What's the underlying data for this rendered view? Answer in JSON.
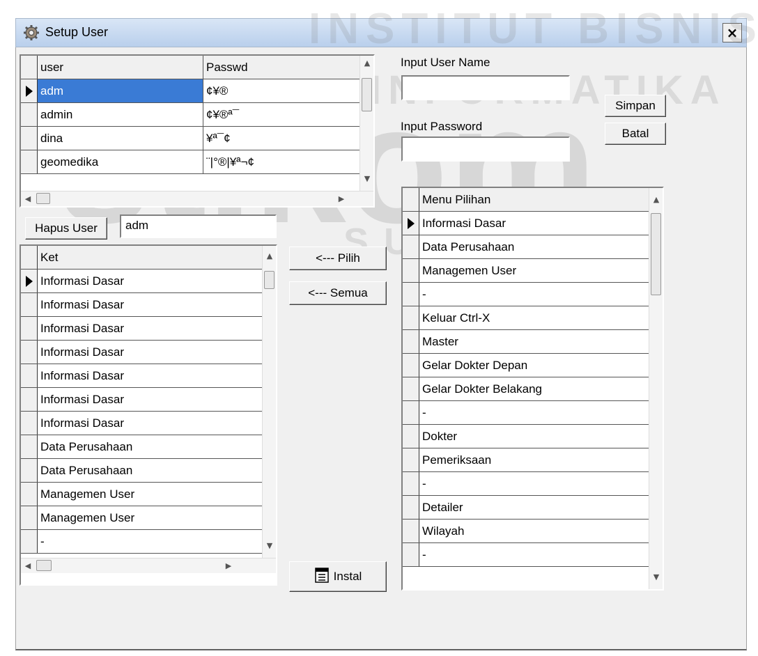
{
  "window": {
    "title": "Setup User",
    "close_label": "×"
  },
  "watermark": {
    "line1": "INSTITUT BISNIS",
    "line2": "& INFORMATIKA",
    "logo": "stikom",
    "line3": "SURABAYA"
  },
  "user_grid": {
    "headers": [
      "user",
      "Passwd"
    ],
    "rows": [
      [
        "adm",
        "¢¥®"
      ],
      [
        "admin",
        "¢¥®ª¯"
      ],
      [
        "dina",
        "¥ª¯¢"
      ],
      [
        "geomedika",
        "¨|°®|¥ª¬¢"
      ]
    ]
  },
  "form": {
    "user_name_label": "Input User Name",
    "password_label": "Input Password",
    "user_name_value": "",
    "password_value": "",
    "simpan_label": "Simpan",
    "batal_label": "Batal",
    "hapus_label": "Hapus User",
    "hapus_value": "adm"
  },
  "ket_grid": {
    "header": "Ket",
    "rows": [
      "Informasi Dasar",
      "Informasi Dasar",
      "Informasi Dasar",
      "Informasi Dasar",
      "Informasi Dasar",
      "Informasi Dasar",
      "Informasi Dasar",
      "Data Perusahaan",
      "Data Perusahaan",
      "Managemen User",
      "Managemen User",
      "-"
    ]
  },
  "actions": {
    "pilih_label": "<--- Pilih",
    "semua_label": "<--- Semua",
    "instal_label": "Instal"
  },
  "menu_grid": {
    "header": "Menu Pilihan",
    "rows": [
      "Informasi Dasar",
      "Data Perusahaan",
      "Managemen User",
      "-",
      "Keluar   Ctrl-X",
      "Master",
      "Gelar Dokter Depan",
      "Gelar Dokter Belakang",
      "-",
      "Dokter",
      "Pemeriksaan",
      "-",
      "Detailer",
      "Wilayah",
      "-"
    ]
  }
}
